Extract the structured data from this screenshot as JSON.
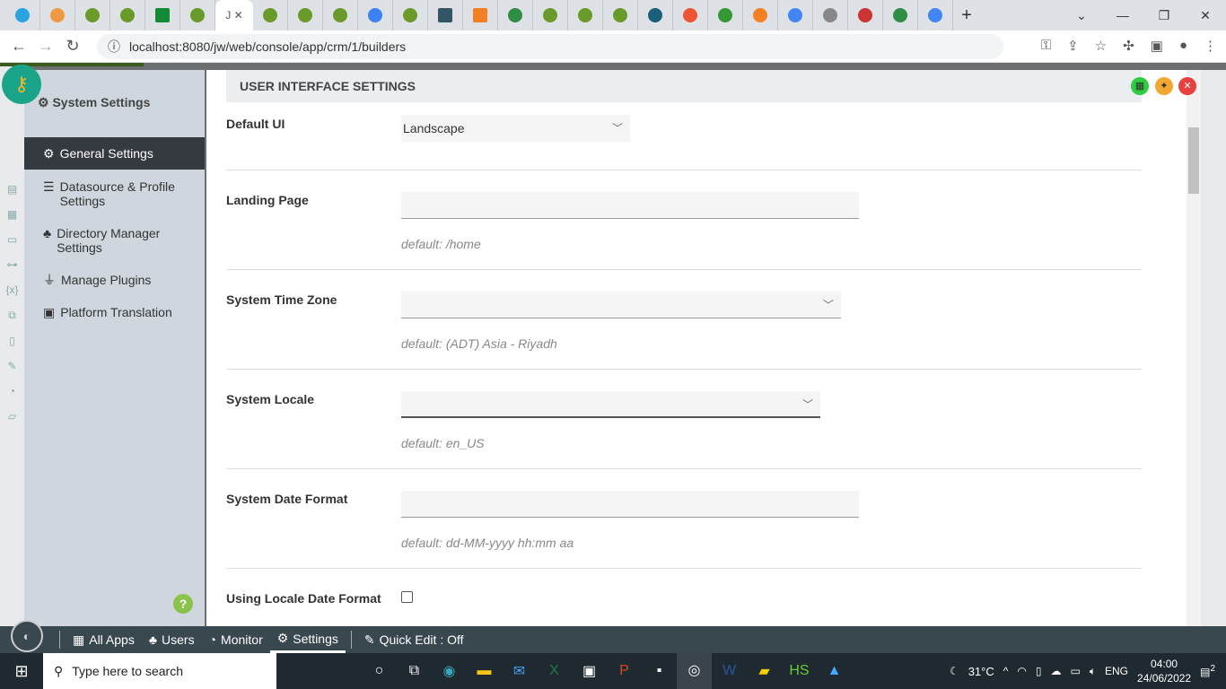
{
  "browser": {
    "active_tab_label": "J",
    "url": "localhost:8080/jw/web/console/app/crm/1/builders"
  },
  "sidebar": {
    "title": "System Settings",
    "items": [
      {
        "label": "General Settings",
        "icon": "gear-icon"
      },
      {
        "label": "Datasource & Profile Settings",
        "icon": "database-icon"
      },
      {
        "label": "Directory Manager Settings",
        "icon": "users-icon"
      },
      {
        "label": "Manage Plugins",
        "icon": "plug-icon"
      },
      {
        "label": "Platform Translation",
        "icon": "translate-icon"
      }
    ],
    "help": "?"
  },
  "main": {
    "header": "USER INTERFACE SETTINGS",
    "fields": [
      {
        "label": "Default UI",
        "value": "Landscape"
      },
      {
        "label": "Landing Page",
        "value": "",
        "hint": "default: /home"
      },
      {
        "label": "System Time Zone",
        "value": "",
        "hint": "default: (ADT) Asia - Riyadh"
      },
      {
        "label": "System Locale",
        "value": "",
        "hint": "default: en_US"
      },
      {
        "label": "System Date Format",
        "value": "",
        "hint": "default: dd-MM-yyyy hh:mm aa"
      },
      {
        "label": "Using Locale Date Format",
        "checked": false
      }
    ]
  },
  "bottombar": {
    "all_apps": "All Apps",
    "users": "Users",
    "monitor": "Monitor",
    "settings": "Settings",
    "quick_edit": "Quick Edit : Off"
  },
  "taskbar": {
    "search_placeholder": "Type here to search",
    "weather": "31°C",
    "lang": "ENG",
    "time": "04:00",
    "date": "24/06/2022",
    "notifications": "2"
  }
}
